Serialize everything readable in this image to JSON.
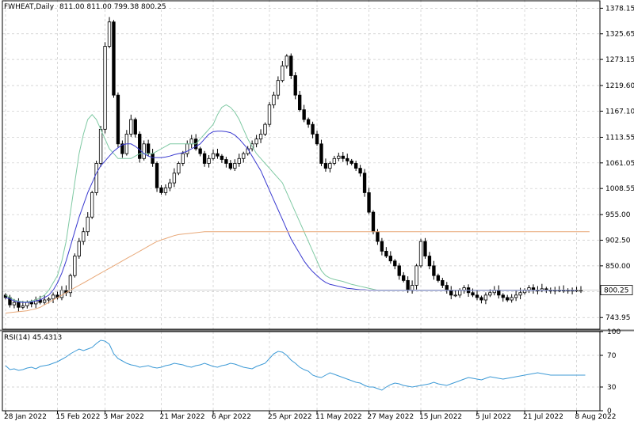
{
  "header": {
    "symbol_label": "FWHEAT,Daily",
    "ohlc_text": "811.00 811.00 799.38 800.25"
  },
  "rsi_header": {
    "label": "RSI(14) 45.4313"
  },
  "colors": {
    "background": "#ffffff",
    "grid": "#c8c8c8",
    "candle": "#000000",
    "ma_fast": "#7fc9a3",
    "ma_mid": "#3a3ad0",
    "ma_slow": "#e8a878",
    "rsi_line": "#3d9ad6",
    "price_tag_bg": "#ffffff"
  },
  "chart_data": [
    {
      "type": "candlestick",
      "title": "FWHEAT,Daily",
      "ylim": [
        720,
        1395
      ],
      "y_ticks": [
        743.95,
        796.8,
        850.0,
        902.5,
        955.0,
        1008.55,
        1061.05,
        1113.55,
        1167.1,
        1219.6,
        1273.15,
        1325.65,
        1378.15
      ],
      "y_tick_labels": [
        "743.95",
        "",
        "850.00",
        "902.50",
        "955.00",
        "1008.55",
        "1061.05",
        "1113.55",
        "1167.10",
        "1219.60",
        "1273.15",
        "1325.65",
        "1378.15"
      ],
      "current_price": 800.25,
      "current_price_label": "800.25",
      "x_tick_labels": [
        "28 Jan 2022",
        "15 Feb 2022",
        "3 Mar 2022",
        "21 Mar 2022",
        "6 Apr 2022",
        "25 Apr 2022",
        "11 May 2022",
        "27 May 2022",
        "15 Jun 2022",
        "5 Jul 2022",
        "21 Jul 2022",
        "8 Aug 2022"
      ],
      "x_tick_bar_index": [
        0,
        12,
        23,
        36,
        48,
        61,
        72,
        84,
        96,
        109,
        120,
        132
      ],
      "grid": true,
      "candles_close": [
        785,
        770,
        775,
        765,
        768,
        775,
        772,
        780,
        775,
        780,
        782,
        790,
        785,
        800,
        795,
        830,
        870,
        900,
        920,
        950,
        1000,
        1060,
        1130,
        1300,
        1350,
        1200,
        1100,
        1080,
        1120,
        1150,
        1120,
        1070,
        1100,
        1080,
        1060,
        1010,
        1000,
        1010,
        1020,
        1040,
        1060,
        1080,
        1100,
        1110,
        1090,
        1080,
        1060,
        1070,
        1080,
        1075,
        1068,
        1060,
        1050,
        1060,
        1070,
        1080,
        1090,
        1100,
        1110,
        1120,
        1140,
        1180,
        1200,
        1230,
        1260,
        1280,
        1240,
        1200,
        1170,
        1150,
        1140,
        1120,
        1100,
        1060,
        1050,
        1060,
        1070,
        1075,
        1070,
        1065,
        1060,
        1050,
        1040,
        1000,
        960,
        920,
        900,
        880,
        870,
        860,
        850,
        830,
        820,
        800,
        810,
        850,
        900,
        870,
        850,
        830,
        820,
        810,
        800,
        790,
        790,
        800,
        805,
        795,
        790,
        785,
        780,
        790,
        795,
        800,
        790,
        785,
        780,
        785,
        790,
        795,
        800,
        805,
        800,
        800,
        803,
        800,
        800,
        800,
        800,
        800,
        800,
        800,
        800,
        800
      ],
      "series": [
        {
          "name": "",
          "color_key": "ma_fast",
          "values": [
            790,
            785,
            780,
            778,
            776,
            776,
            778,
            780,
            785,
            790,
            800,
            815,
            830,
            860,
            900,
            960,
            1020,
            1080,
            1120,
            1150,
            1160,
            1150,
            1130,
            1110,
            1090,
            1080,
            1070,
            1070,
            1070,
            1070,
            1075,
            1080,
            1080,
            1080,
            1080,
            1085,
            1090,
            1095,
            1100,
            1100,
            1100,
            1100,
            1100,
            1100,
            1100,
            1110,
            1120,
            1130,
            1140,
            1160,
            1175,
            1180,
            1175,
            1165,
            1150,
            1130,
            1110,
            1095,
            1080,
            1070,
            1060,
            1050,
            1040,
            1030,
            1020,
            1000,
            980,
            960,
            940,
            920,
            900,
            880,
            860,
            840,
            830,
            825,
            822,
            820,
            818,
            815,
            812,
            810,
            808,
            806,
            804,
            802,
            800,
            800,
            800,
            800,
            800,
            800,
            800,
            800,
            800,
            800,
            800,
            800,
            800,
            800,
            800,
            800,
            800,
            800,
            800,
            800,
            800,
            800,
            800,
            800,
            800,
            800,
            800,
            800,
            800,
            800,
            800,
            800,
            800,
            800,
            800,
            800,
            800,
            800,
            800,
            800,
            800,
            800,
            800,
            800,
            800,
            800,
            800
          ]
        },
        {
          "name": "",
          "color_key": "ma_mid",
          "values": [
            785,
            782,
            778,
            776,
            775,
            775,
            776,
            778,
            780,
            785,
            790,
            800,
            815,
            835,
            860,
            890,
            920,
            950,
            975,
            1000,
            1020,
            1040,
            1055,
            1065,
            1075,
            1085,
            1092,
            1098,
            1100,
            1100,
            1095,
            1088,
            1080,
            1075,
            1072,
            1072,
            1072,
            1073,
            1075,
            1078,
            1080,
            1082,
            1085,
            1090,
            1095,
            1100,
            1110,
            1120,
            1125,
            1126,
            1126,
            1125,
            1123,
            1118,
            1110,
            1100,
            1090,
            1075,
            1060,
            1045,
            1025,
            1005,
            985,
            965,
            945,
            925,
            905,
            890,
            875,
            860,
            848,
            838,
            830,
            822,
            816,
            812,
            810,
            808,
            806,
            804,
            803,
            802,
            801,
            801,
            800,
            800,
            800,
            800,
            800,
            800,
            800,
            800,
            800,
            800,
            800,
            800,
            800,
            800,
            800,
            800,
            800,
            800,
            800,
            800,
            800,
            800,
            800,
            800,
            800,
            800,
            800,
            800,
            800,
            800,
            800,
            800,
            800,
            800,
            800,
            800,
            800,
            800,
            800,
            800,
            800,
            800,
            800,
            800,
            800,
            800,
            800,
            800,
            800
          ]
        },
        {
          "name": "",
          "color_key": "ma_slow",
          "values": [
            753,
            754,
            755,
            756,
            757,
            758,
            760,
            762,
            765,
            770,
            775,
            780,
            785,
            790,
            795,
            800,
            805,
            810,
            815,
            820,
            825,
            830,
            835,
            840,
            845,
            850,
            855,
            860,
            865,
            870,
            875,
            880,
            885,
            890,
            895,
            900,
            903,
            906,
            909,
            912,
            914,
            915,
            916,
            917,
            918,
            919,
            920,
            920,
            920,
            920,
            920,
            920,
            920,
            920,
            920,
            920,
            920,
            920,
            920,
            920,
            920,
            920,
            920,
            920,
            920,
            920,
            920,
            920,
            920,
            920,
            920,
            920,
            920,
            920,
            920,
            920,
            920,
            920,
            920,
            920,
            920,
            920,
            920,
            920,
            920,
            920,
            920,
            920,
            920,
            920,
            920,
            920,
            920,
            920,
            920,
            920,
            920,
            920,
            920,
            920,
            920,
            920,
            920,
            920,
            920,
            920,
            920,
            920,
            920,
            920,
            920,
            920,
            920,
            920,
            920,
            920,
            920,
            920,
            920,
            920,
            920,
            920,
            920,
            920,
            920,
            920,
            920,
            920,
            920,
            920,
            920,
            920,
            920,
            920,
            920,
            920
          ]
        }
      ]
    },
    {
      "type": "line",
      "title": "RSI(14) 45.4313",
      "ylim": [
        0,
        100
      ],
      "y_ticks": [
        0,
        30,
        70,
        100
      ],
      "y_tick_labels": [
        "0",
        "30",
        "70",
        "100"
      ],
      "series": [
        {
          "name": "RSI(14)",
          "values": [
            57,
            52,
            53,
            51,
            52,
            54,
            55,
            53,
            56,
            57,
            58,
            60,
            62,
            65,
            68,
            72,
            75,
            78,
            76,
            78,
            80,
            85,
            89,
            88,
            84,
            72,
            66,
            63,
            60,
            58,
            57,
            55,
            56,
            57,
            55,
            54,
            55,
            57,
            58,
            60,
            59,
            58,
            56,
            55,
            57,
            58,
            60,
            58,
            56,
            55,
            57,
            58,
            60,
            59,
            57,
            55,
            54,
            53,
            56,
            58,
            60,
            66,
            72,
            75,
            74,
            70,
            64,
            60,
            55,
            52,
            50,
            45,
            43,
            42,
            45,
            48,
            46,
            44,
            42,
            40,
            38,
            36,
            35,
            32,
            30,
            30,
            28,
            26,
            30,
            33,
            35,
            34,
            32,
            31,
            30,
            31,
            32,
            33,
            34,
            36,
            34,
            33,
            32,
            34,
            36,
            38,
            40,
            42,
            41,
            40,
            39,
            41,
            43,
            42,
            41,
            40,
            41,
            42,
            43,
            44,
            45,
            46,
            47,
            48,
            47,
            46,
            45,
            45,
            45,
            45,
            45,
            45,
            45,
            45,
            45
          ]
        }
      ]
    }
  ]
}
